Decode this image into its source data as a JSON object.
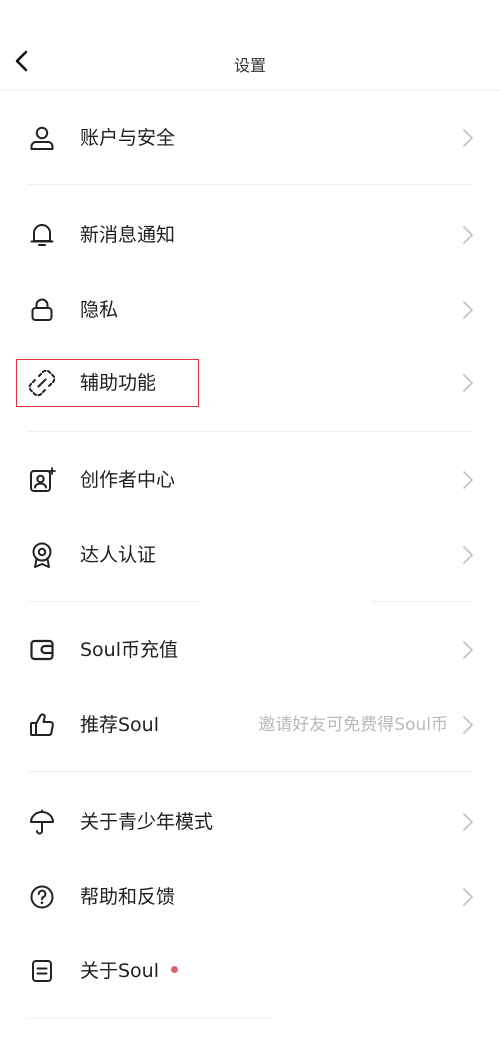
{
  "header": {
    "title": "设置",
    "back_icon": "chevron-left-icon"
  },
  "rows": [
    {
      "label": "账户与安全",
      "icon": "user-icon"
    },
    {
      "label": "新消息通知",
      "icon": "bell-icon"
    },
    {
      "label": "隐私",
      "icon": "lock-icon"
    },
    {
      "label": "辅助功能",
      "icon": "accessibility-link-icon"
    },
    {
      "label": "创作者中心",
      "icon": "creator-profile-icon"
    },
    {
      "label": "达人认证",
      "icon": "award-badge-icon"
    },
    {
      "label": "Soul币充值",
      "icon": "wallet-icon"
    },
    {
      "label": "推荐Soul",
      "icon": "thumbs-up-icon",
      "hint": "邀请好友可免费得Soul币"
    },
    {
      "label": "关于青少年模式",
      "icon": "umbrella-icon"
    },
    {
      "label": "帮助和反馈",
      "icon": "help-circle-icon"
    },
    {
      "label": "关于Soul",
      "icon": "document-icon"
    }
  ],
  "colors": {
    "highlight_border": "#e0303a",
    "new_dot": "#e0606a",
    "chevron": "#c4c4c4",
    "text": "#1f1f1f",
    "hint_text": "#b9b9b9"
  }
}
